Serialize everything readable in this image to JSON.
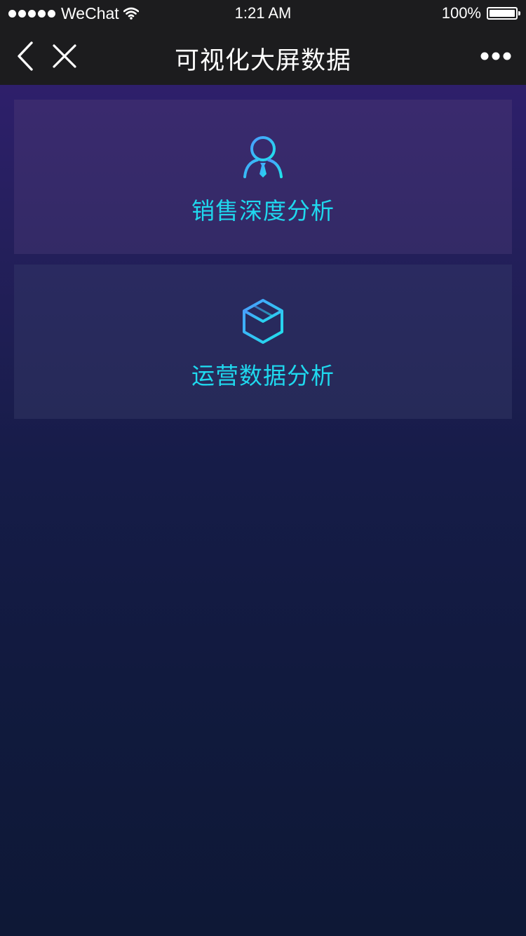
{
  "status_bar": {
    "carrier": "WeChat",
    "time": "1:21 AM",
    "battery": "100%",
    "battery_level": 1.0
  },
  "nav": {
    "title": "可视化大屏数据",
    "back_icon": "chevron-left-icon",
    "close_icon": "close-icon",
    "more_icon": "more-icon"
  },
  "cards": [
    {
      "label": "销售深度分析",
      "icon": "user-tie-icon"
    },
    {
      "label": "运营数据分析",
      "icon": "cube-icon"
    }
  ],
  "colors": {
    "accent": "#1fd8ee",
    "bar": "#1c1c1e",
    "background_top": "#2e1f6b",
    "background_bottom": "#0e1836"
  }
}
